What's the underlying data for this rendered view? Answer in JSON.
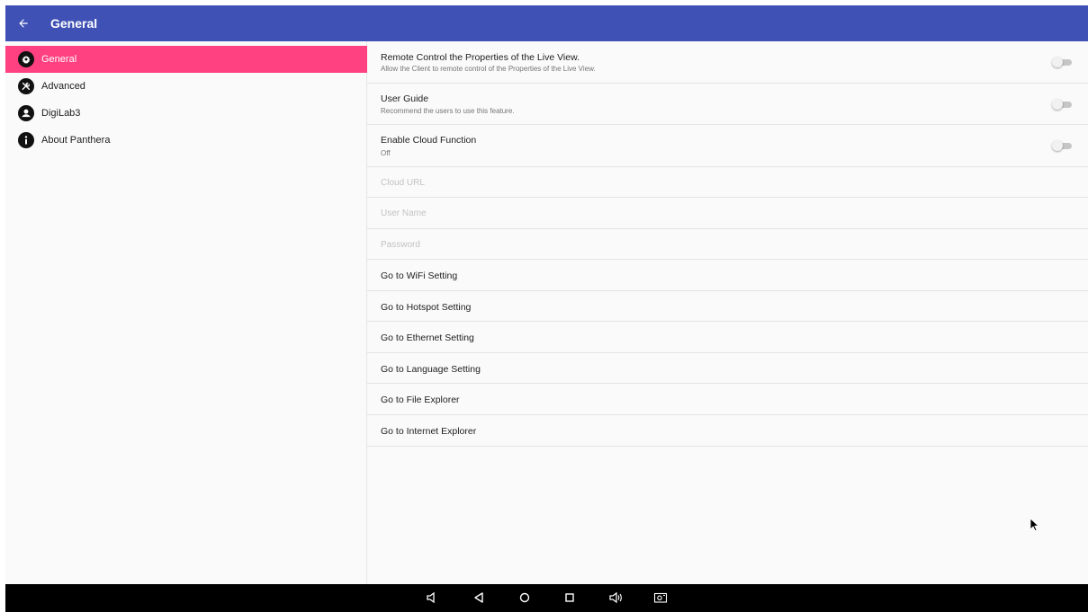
{
  "appbar": {
    "title": "General",
    "back_icon": "arrow-left-icon"
  },
  "sidebar": {
    "items": [
      {
        "label": "General",
        "icon": "gear-icon",
        "active": true
      },
      {
        "label": "Advanced",
        "icon": "tools-icon",
        "active": false
      },
      {
        "label": "DigiLab3",
        "icon": "account-icon",
        "active": false
      },
      {
        "label": "About Panthera",
        "icon": "info-icon",
        "active": false
      }
    ],
    "active_color": "#ff4081"
  },
  "settings": {
    "remote_control": {
      "title": "Remote Control the Properties of the Live View.",
      "summary": "Allow the Client to remote control of the Properties of the Live View.",
      "enabled": false
    },
    "user_guide": {
      "title": "User Guide",
      "summary": "Recommend the users to use this feature.",
      "enabled": false
    },
    "cloud_function": {
      "title": "Enable Cloud Function",
      "summary": "Off",
      "enabled": false
    },
    "cloud_url": {
      "placeholder": "Cloud URL"
    },
    "user_name": {
      "placeholder": "User Name"
    },
    "password": {
      "placeholder": "Password"
    },
    "links": [
      "Go to WiFi Setting",
      "Go to Hotspot Setting",
      "Go to Ethernet Setting",
      "Go to Language Setting",
      "Go to File Explorer",
      "Go to Internet Explorer"
    ]
  },
  "navbar": {
    "buttons": [
      "volume-down-icon",
      "back-triangle-icon",
      "home-circle-icon",
      "recents-square-icon",
      "volume-up-icon",
      "screenshot-icon"
    ]
  },
  "theme": {
    "primary": "#3f51b5",
    "accent": "#ff4081"
  }
}
